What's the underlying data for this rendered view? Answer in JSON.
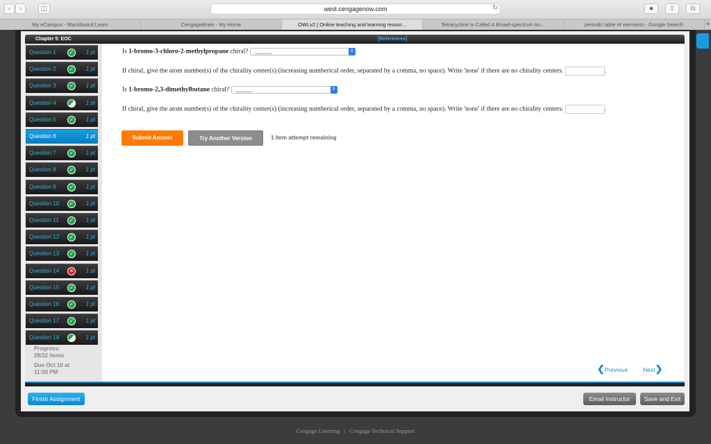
{
  "browser": {
    "url": "west.cengagenow.com",
    "tabs": [
      "My eCampus - Blackboard Learn",
      "CengageBrain - My Home",
      "OWLv2 | Online teaching and learning resour...",
      "Tetracycline Is Called A Broad-spectrum An...",
      "periodic table of elements - Google Search"
    ],
    "active_tab": 2
  },
  "header": {
    "chapter": "Chapter 5: EOC",
    "references": "[References]"
  },
  "questions": [
    {
      "label": "Question 1",
      "status": "correct",
      "points": "1 pt"
    },
    {
      "label": "Question 2",
      "status": "correct",
      "points": "1 pt"
    },
    {
      "label": "Question 3",
      "status": "correct",
      "points": "1 pt"
    },
    {
      "label": "Question 4",
      "status": "partial",
      "points": "1 pt"
    },
    {
      "label": "Question 5",
      "status": "correct",
      "points": "1 pt"
    },
    {
      "label": "Question 6",
      "status": "current",
      "points": "1 pt"
    },
    {
      "label": "Question 7",
      "status": "correct",
      "points": "1 pt"
    },
    {
      "label": "Question 8",
      "status": "correct",
      "points": "1 pt"
    },
    {
      "label": "Question 9",
      "status": "correct",
      "points": "1 pt"
    },
    {
      "label": "Question 10",
      "status": "correct",
      "points": "1 pt"
    },
    {
      "label": "Question 11",
      "status": "correct",
      "points": "1 pt"
    },
    {
      "label": "Question 12",
      "status": "correct",
      "points": "1 pt"
    },
    {
      "label": "Question 13",
      "status": "correct",
      "points": "1 pt"
    },
    {
      "label": "Question 14",
      "status": "incorrect",
      "points": "1 pt"
    },
    {
      "label": "Question 15",
      "status": "correct",
      "points": "1 pt"
    },
    {
      "label": "Question 16",
      "status": "correct",
      "points": "1 pt"
    },
    {
      "label": "Question 17",
      "status": "correct",
      "points": "1 pt"
    },
    {
      "label": "Question 18",
      "status": "partial",
      "points": "1 pt"
    }
  ],
  "progress": {
    "label": "Progress:",
    "value": "28/32 items",
    "due1": "Due Oct 10 at",
    "due2": "11:50 PM"
  },
  "content": {
    "q1_pre": "Is ",
    "q1_bold": "1-bromo-3-chloro-2-methylpropane",
    "q1_post": " chiral?",
    "q1_select": "______",
    "q2_text": "If chiral, give the atom number(s) of the chirality center(s) (increasing numberical order, separated by a comma, no space). Write 'none' if there are no chirality centers.",
    "q3_pre": "Is ",
    "q3_bold": "1-bromo-2,3-dimethylbutane",
    "q3_post": " chiral?",
    "q3_select": "______",
    "q4_text": "If chiral, give the atom number(s) of the chirality center(s) (increasing numberical order, separated by a comma, no space). Write 'none' if there are no chirality centers.",
    "period": ".",
    "submit": "Submit Answer",
    "try_another": "Try Another Version",
    "attempts": "1 item attempt remaining",
    "previous": "Previous",
    "next": "Next"
  },
  "actions": {
    "finish": "Finish Assignment",
    "email": "Email Instructor",
    "save_exit": "Save and Exit"
  },
  "footer": {
    "left": "Cengage Learning",
    "sep": "|",
    "right": "Cengage Technical Support"
  },
  "colors": {
    "accent": "#1a9de0",
    "submit": "#ff7a00",
    "correct": "#1aa34a",
    "incorrect": "#d0202a"
  }
}
